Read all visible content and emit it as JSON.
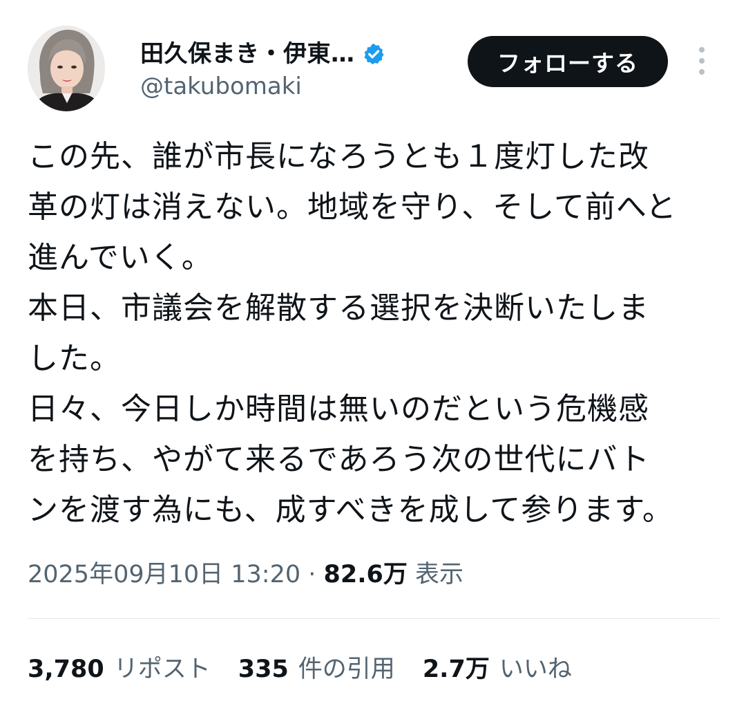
{
  "header": {
    "display_name": "田久保まき・伊東…",
    "handle": "@takubomaki",
    "follow_label": "フォローする",
    "verified_icon": "verified-badge-icon",
    "more_icon": "more-vertical-icon"
  },
  "post": {
    "lines": [
      "この先、誰が市長になろうとも１度灯した改",
      "革の灯は消えない。地域を守り、そして前へと",
      "進んでいく。",
      "本日、市議会を解散する選択を決断いたしま",
      "した。",
      "日々、今日しか時間は無いのだという危機感",
      "を持ち、やがて来るであろう次の世代にバト",
      "ンを渡す為にも、成すべきを成して参ります。"
    ]
  },
  "meta": {
    "timestamp": "2025年09月10日 13:20",
    "separator": " · ",
    "views_count": "82.6万",
    "views_label": "表示"
  },
  "stats": {
    "reposts_count": "3,780",
    "reposts_label": "リポスト",
    "quotes_count": "335",
    "quotes_label": "件の引用",
    "likes_count": "2.7万",
    "likes_label": "いいね"
  },
  "colors": {
    "text_primary": "#0f1419",
    "text_secondary": "#536471",
    "verified_blue": "#1d9bf0",
    "button_bg": "#0f1419",
    "divider": "#e7e9ea"
  }
}
